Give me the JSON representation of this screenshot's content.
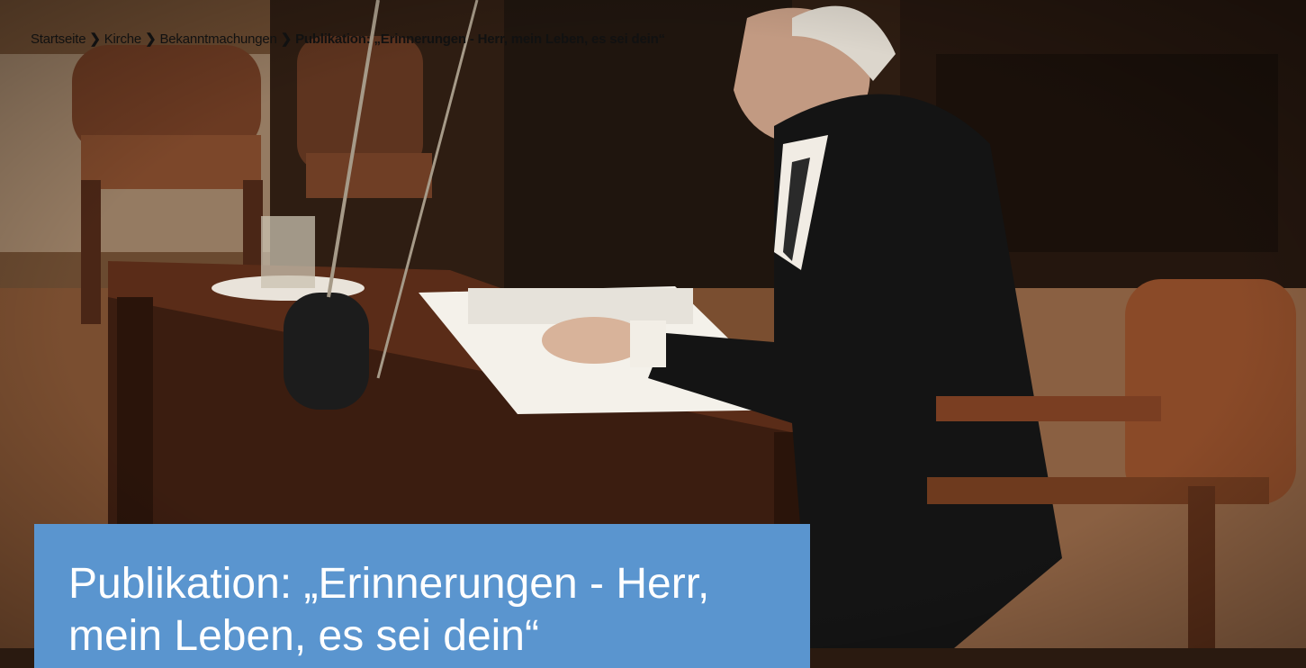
{
  "breadcrumb": {
    "items": [
      {
        "label": "Startseite"
      },
      {
        "label": "Kirche"
      },
      {
        "label": "Bekanntmachungen"
      }
    ],
    "current": "Publikation: „Erinnerungen - Herr, mein Leben, es sei dein“",
    "separator": "❯"
  },
  "hero": {
    "title": "Publikation: „Erinnerungen - Herr, mein Leben, es sei dein“"
  },
  "colors": {
    "title_box": "#5a95cf",
    "title_text": "#ffffff"
  }
}
